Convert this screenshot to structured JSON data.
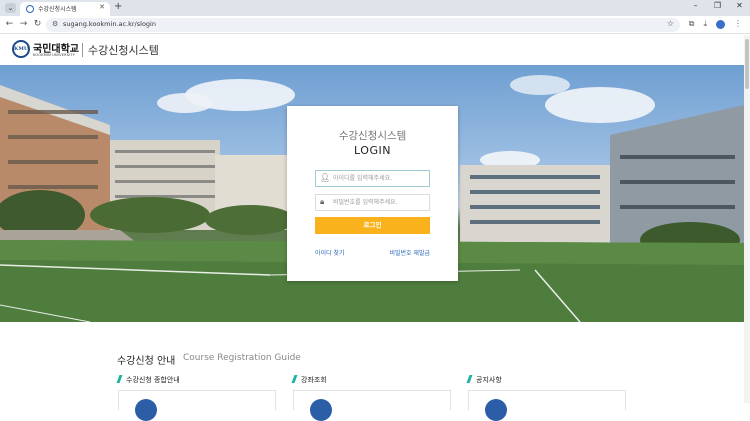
{
  "browser": {
    "tab_title": "수강신청시스템",
    "url": "sugang.kookmin.ac.kr/slogin"
  },
  "header": {
    "logo_emblem": "KMU",
    "logo_name": "국민대학교",
    "logo_subtext": "KOOKMIN UNIVERSITY",
    "title": "수강신청시스템"
  },
  "login": {
    "title": "수강신청시스템",
    "subtitle": "LOGIN",
    "id_placeholder": "아이디를 입력해주세요.",
    "pw_placeholder": "비밀번호를 입력해주세요.",
    "button_label": "로그인",
    "find_id_label": "아이디 찾기",
    "reset_pw_label": "비밀번호 재발급"
  },
  "guide": {
    "title": "수강신청 안내",
    "subtitle": "Course Registration Guide",
    "columns": [
      {
        "label": "수강신청 종합안내"
      },
      {
        "label": "강좌조회"
      },
      {
        "label": "공지사항"
      }
    ]
  },
  "colors": {
    "accent_yellow": "#f9b21b",
    "link_blue": "#2b66b6",
    "teal": "#20b3a5",
    "brand_navy": "#1d4a8c"
  }
}
